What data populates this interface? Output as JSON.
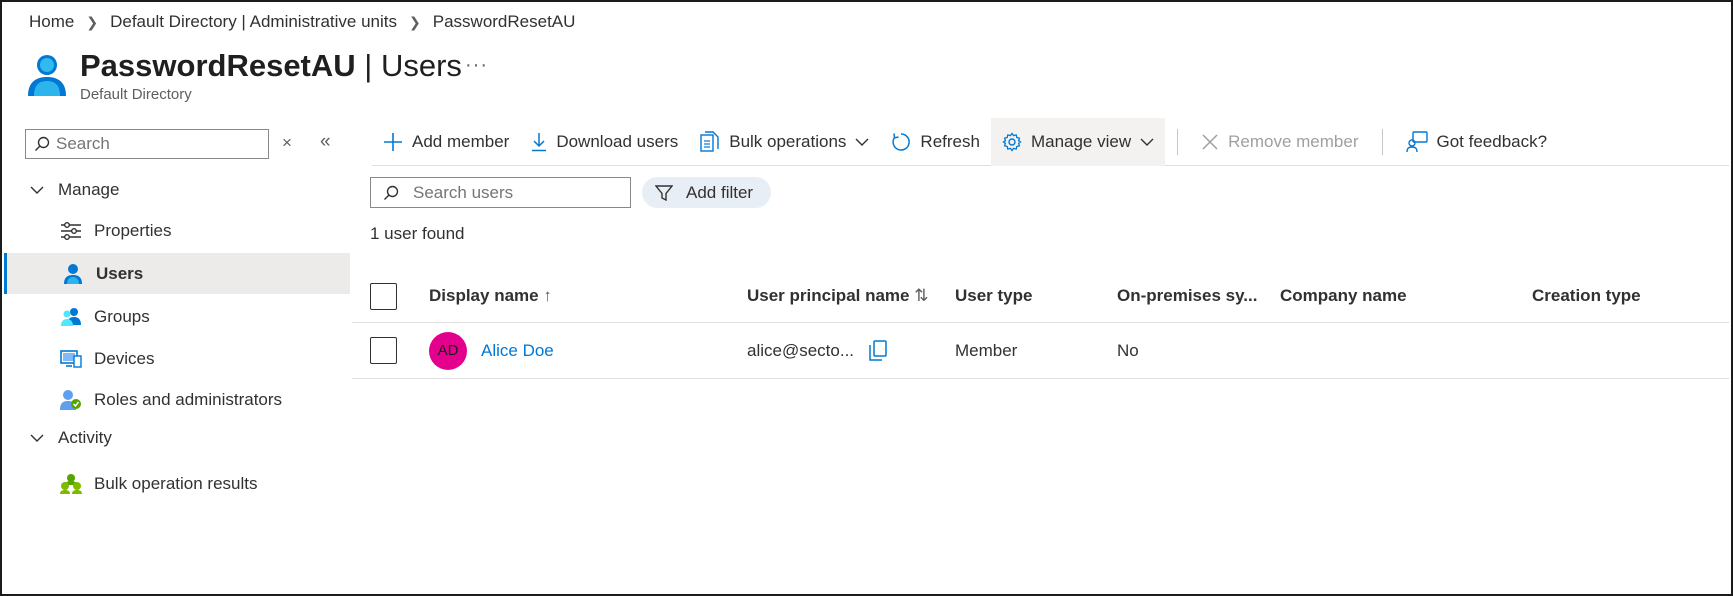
{
  "breadcrumb": {
    "items": [
      "Home",
      "Default Directory | Administrative units",
      "PasswordResetAU"
    ],
    "separator": ">"
  },
  "header": {
    "resource": "PasswordResetAU",
    "divider": "|",
    "page": "Users",
    "subtitle": "Default Directory",
    "more": "···"
  },
  "sidebar": {
    "search_placeholder": "Search",
    "clear": "×",
    "collapse": "«",
    "groups": [
      {
        "label": "Manage",
        "items": [
          {
            "label": "Properties",
            "icon": "sliders-icon"
          },
          {
            "label": "Users",
            "icon": "user-icon",
            "active": true
          },
          {
            "label": "Groups",
            "icon": "groups-icon"
          },
          {
            "label": "Devices",
            "icon": "devices-icon"
          },
          {
            "label": "Roles and administrators",
            "icon": "roles-icon"
          }
        ]
      },
      {
        "label": "Activity",
        "items": [
          {
            "label": "Bulk operation results",
            "icon": "bulk-results-icon"
          }
        ]
      }
    ]
  },
  "toolbar": {
    "add_member": "Add member",
    "download_users": "Download users",
    "bulk_operations": "Bulk operations",
    "refresh": "Refresh",
    "manage_view": "Manage view",
    "remove_member": "Remove member",
    "got_feedback": "Got feedback?"
  },
  "filters": {
    "search_placeholder": "Search users",
    "add_filter": "Add filter"
  },
  "results": {
    "count_text": "1 user found"
  },
  "table": {
    "columns": {
      "display_name": "Display name",
      "display_name_sort": "↑",
      "upn": "User principal name",
      "upn_sort": "⇅",
      "user_type": "User type",
      "onprem": "On-premises sy...",
      "company": "Company name",
      "creation": "Creation type"
    },
    "rows": [
      {
        "initials": "AD",
        "display_name": "Alice Doe",
        "upn": "alice@secto...",
        "user_type": "Member",
        "onprem": "No",
        "company": "",
        "creation": ""
      }
    ]
  },
  "colors": {
    "accent": "#0078d4",
    "avatar": "#e3008c",
    "filter_pill": "#e8eef6"
  }
}
